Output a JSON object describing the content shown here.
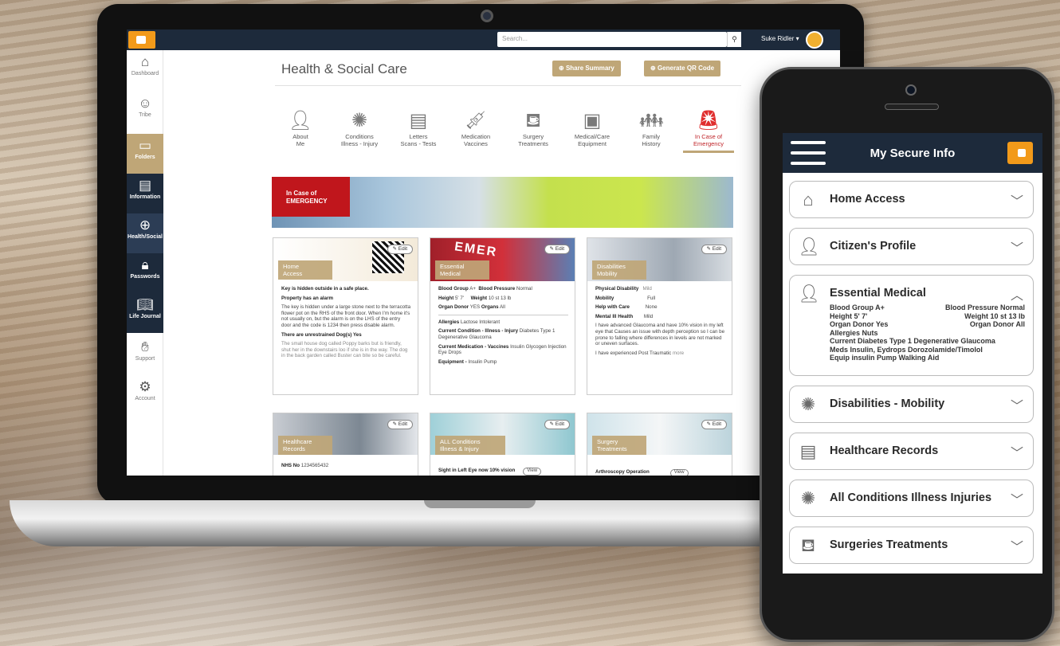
{
  "topbar": {
    "search_placeholder": "Search...",
    "search_icon": "search-icon",
    "user_name": "Suke Ridler ▾"
  },
  "sidebar": {
    "items": [
      {
        "label": "Dashboard",
        "icon": "home-icon"
      },
      {
        "label": "Tribe",
        "icon": "people-icon"
      },
      {
        "label": "Folders",
        "icon": "folder-icon"
      },
      {
        "label": "Information",
        "icon": "document-icon"
      },
      {
        "label": "Health/Social",
        "icon": "health-icon"
      },
      {
        "label": "Passwords",
        "icon": "lock-icon"
      },
      {
        "label": "Life Journal",
        "icon": "book-icon"
      },
      {
        "label": "Support",
        "icon": "handshake-icon"
      },
      {
        "label": "Account",
        "icon": "gears-icon"
      }
    ]
  },
  "main": {
    "title": "Health & Social Care",
    "share_btn": "Share Summary",
    "qr_btn": "Generate QR Code",
    "categories": [
      {
        "l1": "About",
        "l2": "Me"
      },
      {
        "l1": "Conditions",
        "l2": "Illness - Injury"
      },
      {
        "l1": "Letters",
        "l2": "Scans - Tests"
      },
      {
        "l1": "Medication",
        "l2": "Vaccines"
      },
      {
        "l1": "Surgery",
        "l2": "Treatments"
      },
      {
        "l1": "Medical/Care",
        "l2": "Equipment"
      },
      {
        "l1": "Family",
        "l2": "History"
      },
      {
        "l1": "In Case of",
        "l2": "Emergency"
      }
    ],
    "banner": {
      "l1": "In Case of",
      "l2": "EMERGENCY"
    },
    "edit_label": "✎ Edit",
    "cards": {
      "home": {
        "tag1": "Home",
        "tag2": "Access",
        "p1": "Key is hidden outside in a safe place.",
        "p2": "Property has an alarm",
        "p3": "The key is hidden under a large stone next to the terracotta flower pot on the RHS of the front door. When I'm home it's not usually on, but the alarm is on the  LHS of the entry door and the code is 1234 then press disable alarm.",
        "p4": "There are unrestrained  Dog(s)  Yes",
        "p5": "The small house dog  called Poppy barks but is friendly, shut her in the downstairs loo if she is in the way. The dog in the back garden called Buster can bite so be careful."
      },
      "medical": {
        "tag1": "Essential",
        "tag2": "Medical",
        "bg_k": "Blood Group",
        "bg_v": "A+",
        "bp_k": "Blood Pressure",
        "bp_v": "Normal",
        "h_k": "Height",
        "h_v": "5' 7'",
        "w_k": "Weight",
        "w_v": "10 st  13 lb",
        "od_k": "Organ Donor",
        "od_v": "YES",
        "o_k": "Organs",
        "o_v": "All",
        "al_k": "Allergies",
        "al_v": "Lactose Intolerant",
        "cc_k": "Current  Condition - Illness - Injury",
        "cc_v": "Diabetes Type 1 Degenerative Glaucoma",
        "cm_k": "Current  Medication - Vaccines",
        "cm_v": "Insulin Glycogen Injection Eye Drops",
        "eq_k": "Equipment -",
        "eq_v": "Insulin Pump"
      },
      "disab": {
        "tag1": "Disabilities",
        "tag2": "Mobility",
        "pd_k": "Physical Disability",
        "pd_v": "Mild",
        "m_k": "Mobility",
        "m_v": "Full",
        "hc_k": "Help with Care",
        "hc_v": "None",
        "mi_k": "Mental Ill Health",
        "mi_v": "Mild",
        "t1": "I have advanced Glaucoma and have 10% vision in my left eye that Causes an issue with depth perception so I can be prone to falling where differences in levels are not marked or uneven surfaces.",
        "t2": "I have experienced Post Traumatic",
        "more": "more"
      },
      "records": {
        "tag1": "Healthcare",
        "tag2": "Records",
        "nhs_k": "NHS No",
        "nhs_v": "1234565432"
      },
      "conditions": {
        "tag1": "ALL Conditions",
        "tag2": "Illness & Injury",
        "line": "Sight in Left Eye now 10% vision",
        "view": "View"
      },
      "surgery": {
        "tag1": "Surgery",
        "tag2": "Treatments",
        "line": "Arthroscopy Operation",
        "view": "View"
      }
    }
  },
  "phone": {
    "title": "My Secure Info",
    "items": [
      {
        "label": "Home Access",
        "icon": "home-icon"
      },
      {
        "label": "Citizen's Profile",
        "icon": "person-icon"
      },
      {
        "label": "Essential Medical",
        "icon": "medical-person-icon"
      },
      {
        "label": "Disabilities - Mobility",
        "icon": "virus-icon"
      },
      {
        "label": "Healthcare Records",
        "icon": "records-icon"
      },
      {
        "label": "All Conditions Illness Injuries",
        "icon": "virus-icon"
      },
      {
        "label": "Surgeries Treatments",
        "icon": "surgery-bed-icon"
      }
    ],
    "medical": {
      "r1a": "Blood Group A+",
      "r1b": "Blood Pressure Normal",
      "r2a": "Height 5' 7'",
      "r2b": "Weight 10 st  13 lb",
      "r3a": "Organ Donor Yes",
      "r3b": "Organ Donor All",
      "r4": "Allergies Nuts",
      "r5": "Current Diabetes Type 1 Degenerative Glaucoma",
      "r6": "Meds Insulin, Eydrops Dorozolamide/Timolol",
      "r7": "Equip insulin Pump Walking Aid"
    }
  }
}
